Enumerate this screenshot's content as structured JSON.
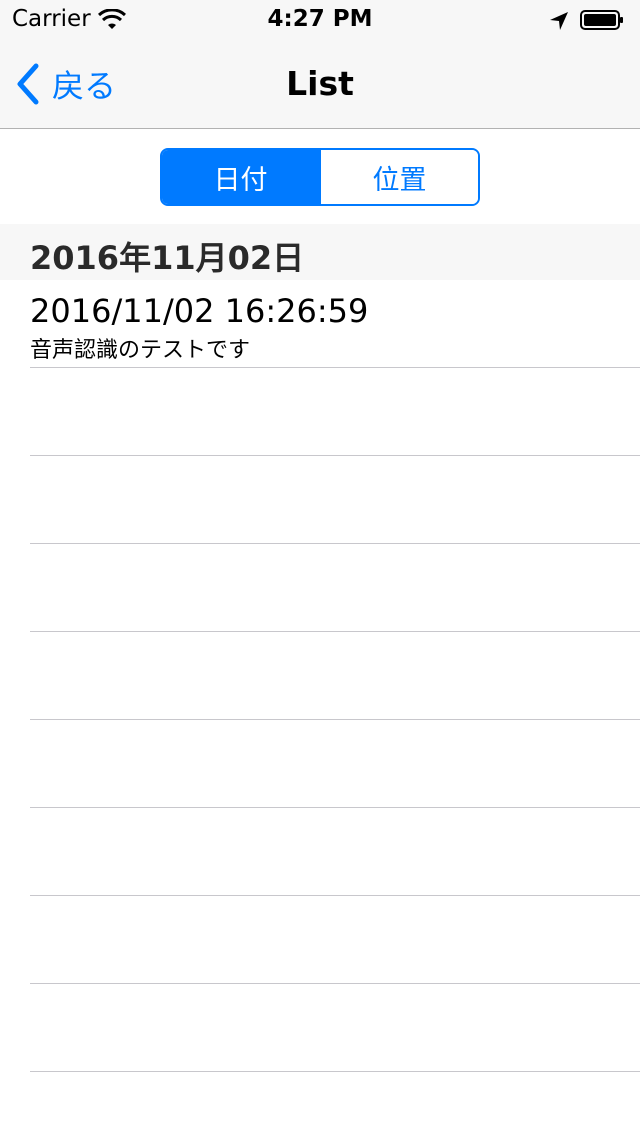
{
  "status_bar": {
    "carrier": "Carrier",
    "time": "4:27 PM"
  },
  "nav": {
    "back_label": "戻る",
    "title": "List"
  },
  "segmented": {
    "options": [
      "日付",
      "位置"
    ],
    "selected": "日付"
  },
  "list": {
    "section_title": "2016年11月02日",
    "items": [
      {
        "title": "2016/11/02 16:26:59",
        "subtitle": "音声認識のテストです"
      }
    ]
  },
  "colors": {
    "accent": "#007aff",
    "bar_background": "#f7f7f7",
    "separator": "#c8c7cc"
  }
}
